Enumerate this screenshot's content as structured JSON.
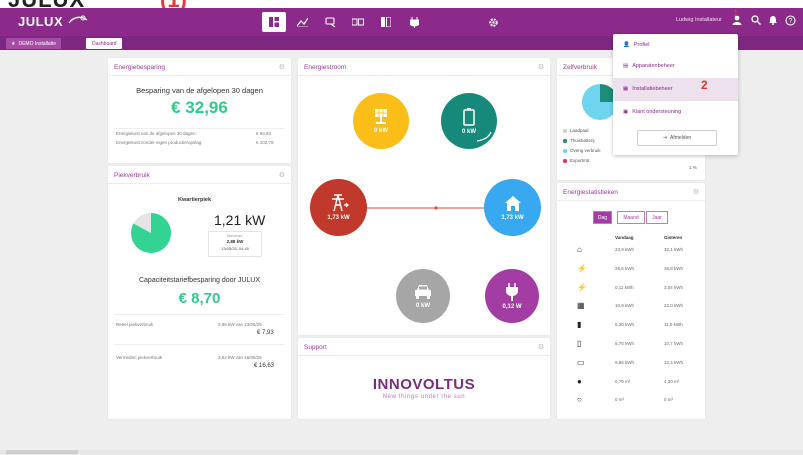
{
  "header": {
    "logo": "JULUX",
    "nav": [
      "dashboard-icon",
      "chart-icon",
      "search-icon",
      "battery-icon",
      "device-icon",
      "plug-icon",
      "gear-icon"
    ],
    "user_name": "Ludwig Installateur",
    "brand_color": "#8b2a8a"
  },
  "breadcrumb": {
    "home": "DEMO Installatie",
    "page": "Dashboard"
  },
  "energiebesparing": {
    "title": "Energiebesparing",
    "subtitle": "Besparing van de afgelopen 30 dagen",
    "amount": "€ 32,96",
    "rows": [
      {
        "label": "Energiekost van de afgelopen 30 dagen:",
        "value": "€ 69,83"
      },
      {
        "label": "Energiekost zonder eigen productie/opslag:",
        "value": "€ 102,79"
      }
    ]
  },
  "piekverbruik": {
    "title": "Piekverbruik",
    "subtitle": "Kwartierpiek",
    "value": "1,21 kW",
    "max_label": "Maximum",
    "max_value": "2,88 kW",
    "max_date": "13/05/25, 04:45",
    "capaciteit_title": "Capaciteitstariefbesparing door JULUX",
    "capaciteit_amount": "€ 8,70",
    "rows": [
      {
        "label": "Reëel piekverbruik",
        "line1": "2,88 kW van 13/05/25",
        "line2": "€ 7,93"
      },
      {
        "label": "Vermeden piekverbruik",
        "line1": "3,62 kW van 16/05/25",
        "line2": "€ 16,63"
      }
    ]
  },
  "energiestroom": {
    "title": "Energiestroom",
    "solar": "0 kW",
    "battery": "0 kW",
    "grid": "1,73 kW",
    "home": "1,73 kW",
    "car": "0 kW",
    "plug": "0,12 W"
  },
  "support": {
    "title": "Support",
    "brand": "INNOVOLTUS",
    "tagline": "New things under the sun"
  },
  "zelfverbruik": {
    "title": "Zelfverbruik",
    "legend": [
      {
        "label": "Laadpaal",
        "value": "",
        "color": "#cccccc"
      },
      {
        "label": "Thuisbatterij",
        "value": "",
        "color": "#1f8b7a"
      },
      {
        "label": "Overig verbruik",
        "value": "",
        "color": "#6ed4f0"
      },
      {
        "label": "Exportmtr.",
        "value": "1 %",
        "color": "#d9376e"
      }
    ]
  },
  "energiestatistieken": {
    "title": "Energiestatistieken",
    "tabs": [
      "Dag",
      "Maand",
      "Jaar"
    ],
    "col_today": "Vandaag",
    "col_yesterday": "Gisteren",
    "rows": [
      {
        "icon": "home-icon",
        "today": "23,9 kWh",
        "yesterday": "32,1 kWh"
      },
      {
        "icon": "grid-import-icon",
        "today": "26,6 kWh",
        "yesterday": "36,8 kWh"
      },
      {
        "icon": "grid-export-icon",
        "today": "0,11 kWh",
        "yesterday": "3,04 kWh"
      },
      {
        "icon": "solar-icon",
        "today": "10,9 kWh",
        "yesterday": "22,0 kWh"
      },
      {
        "icon": "battery-charge-icon",
        "today": "6,30 kWh",
        "yesterday": "11,0 kWh"
      },
      {
        "icon": "battery-discharge-icon",
        "today": "5,70 kWh",
        "yesterday": "10,7 kWh"
      },
      {
        "icon": "car-icon",
        "today": "9,85 kWh",
        "yesterday": "12,4 kWh"
      },
      {
        "icon": "water-icon",
        "today": "0,79 m³",
        "yesterday": "4,30 m³"
      },
      {
        "icon": "gas-icon",
        "today": "0 m³",
        "yesterday": "0 m³"
      }
    ]
  },
  "dropdown": {
    "items": [
      "Profiel",
      "Apparatenbeheer",
      "Installatiebeheer",
      "Klant ondersteuning"
    ],
    "logout": "Afmelden",
    "annotation_2": "2",
    "annotation_1": "1"
  },
  "topbanner": {
    "text": "JULUX",
    "paren": "(1)"
  }
}
